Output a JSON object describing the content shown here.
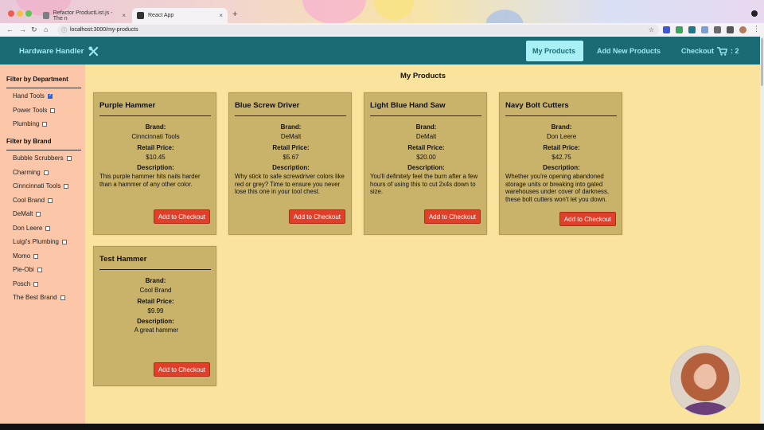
{
  "browser": {
    "tabs": [
      {
        "label": "Refactor ProductList.js - The n",
        "active": false
      },
      {
        "label": "React App",
        "active": true
      }
    ],
    "url": "localhost:3000/my-products"
  },
  "header": {
    "brand": "Hardware Handler",
    "nav": [
      {
        "label": "My Products",
        "active": true
      },
      {
        "label": "Add New Products",
        "active": false
      },
      {
        "label": "Checkout",
        "active": false
      }
    ],
    "cart_count": ": 2"
  },
  "sidebar": {
    "department_heading": "Filter by Department",
    "departments": [
      {
        "label": "Hand Tools",
        "checked": true
      },
      {
        "label": "Power Tools",
        "checked": false
      },
      {
        "label": "Plumbing",
        "checked": false
      }
    ],
    "brand_heading": "Filter by Brand",
    "brands": [
      {
        "label": "Bubble Scrubbers",
        "checked": false
      },
      {
        "label": "Charming",
        "checked": false
      },
      {
        "label": "Cinncinnati Tools",
        "checked": false
      },
      {
        "label": "Cool Brand",
        "checked": false
      },
      {
        "label": "DeMalt",
        "checked": false
      },
      {
        "label": "Don Leere",
        "checked": false
      },
      {
        "label": "Luigi's Plumbing",
        "checked": false
      },
      {
        "label": "Momo",
        "checked": false
      },
      {
        "label": "Pie-Obi",
        "checked": false
      },
      {
        "label": "Posch",
        "checked": false
      },
      {
        "label": "The Best Brand",
        "checked": false
      }
    ]
  },
  "main": {
    "title": "My Products",
    "labels": {
      "brand": "Brand:",
      "price": "Retail Price:",
      "description": "Description:",
      "add": "Add to Checkout"
    },
    "products": [
      {
        "name": "Purple Hammer",
        "brand": "Cinncinnati Tools",
        "price": "$10.45",
        "description": "This purple hammer hits nails harder than a hammer of any other color."
      },
      {
        "name": "Blue Screw Driver",
        "brand": "DeMalt",
        "price": "$5.67",
        "description": "Why stick to safe screwdriver colors like red or grey? Time to ensure you never lose this one in your tool chest."
      },
      {
        "name": "Light Blue Hand Saw",
        "brand": "DeMalt",
        "price": "$20.00",
        "description": "You'll definitely feel the burn after a few hours of using this to cut 2x4s down to size."
      },
      {
        "name": "Navy Bolt Cutters",
        "brand": "Don Leere",
        "price": "$42.75",
        "description": "Whether you're opening abandoned storage units or breaking into gated warehouses under cover of darkness, these bolt cutters won't let you down."
      },
      {
        "name": "Test Hammer",
        "brand": "Cool Brand",
        "price": "$9.99",
        "description": "A great hammer"
      }
    ]
  },
  "colors": {
    "header": "#1b6b75",
    "accent": "#a9f0f6",
    "card": "#c9b26a",
    "button": "#e0402a",
    "sidebar": "#fcc7a8",
    "page": "#fae39c"
  }
}
